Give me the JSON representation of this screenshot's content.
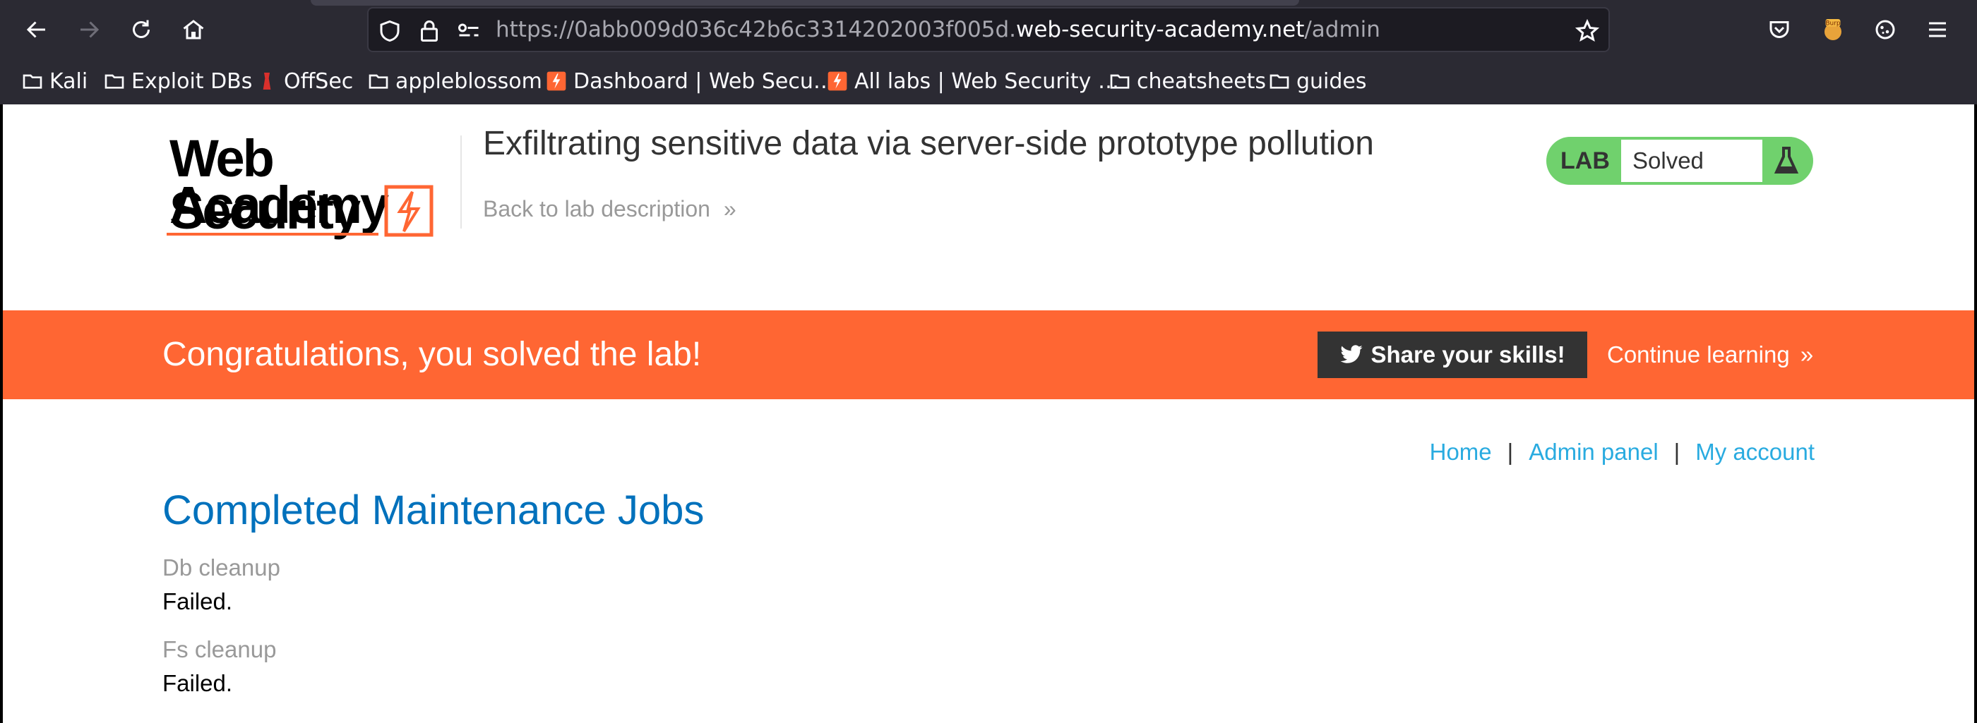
{
  "browser": {
    "url_prefix": "https://0abb009d036c42b6c3314202003f005d.",
    "url_domain": "web-security-academy.net",
    "url_path": "/admin",
    "bookmarks": [
      {
        "label": "Kali",
        "icon": "folder-icon"
      },
      {
        "label": "Exploit DBs",
        "icon": "folder-icon"
      },
      {
        "label": "OffSec",
        "icon": "offsec-icon"
      },
      {
        "label": "appleblossom",
        "icon": "folder-icon"
      },
      {
        "label": "Dashboard | Web Secu…",
        "icon": "portswigger-icon"
      },
      {
        "label": "All labs | Web Security …",
        "icon": "portswigger-icon"
      },
      {
        "label": "cheatsheets",
        "icon": "folder-icon"
      },
      {
        "label": "guides",
        "icon": "folder-icon"
      }
    ],
    "extension_badge": "Burp"
  },
  "header": {
    "logo_line1": "Web Security",
    "logo_line2": "Academy",
    "lab_title": "Exfiltrating sensitive data via server-side prototype pollution",
    "back_link": "Back to lab description",
    "lab_badge_label": "LAB",
    "lab_status": "Solved"
  },
  "banner": {
    "message": "Congratulations, you solved the lab!",
    "share_label": "Share your skills!",
    "continue_label": "Continue learning"
  },
  "nav": {
    "home": "Home",
    "separator": "|",
    "admin": "Admin panel",
    "account": "My account"
  },
  "main": {
    "heading": "Completed Maintenance Jobs",
    "jobs": [
      {
        "name": "Db cleanup",
        "status": "Failed."
      },
      {
        "name": "Fs cleanup",
        "status": "Failed."
      }
    ]
  },
  "colors": {
    "accent": "#ff6633",
    "link": "#29abe0",
    "heading": "#0071bc",
    "badge": "#70d16d"
  }
}
